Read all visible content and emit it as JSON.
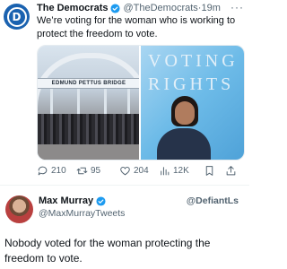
{
  "tweet": {
    "author_name": "The Democrats",
    "author_handle": "@TheDemocrats",
    "separator": "·",
    "time": "19m",
    "more": "···",
    "text": "We’re voting for the woman who is working to protect the freedom to vote.",
    "media": {
      "left_image_sign": "EDMUND PETTUS BRIDGE",
      "right_image_line1": "VOTING",
      "right_image_line2": "RIGHTS"
    },
    "actions": {
      "replies": "210",
      "retweets": "95",
      "likes": "204",
      "views": "12K"
    },
    "verified_color": "#1d9bf0"
  },
  "reply": {
    "author_name": "Max Murray",
    "author_handle": "@MaxMurrayTweets",
    "watermark_handle": "@DefiantLs",
    "text": "Nobody voted for the woman protecting the freedom to vote."
  },
  "colors": {
    "text": "#0f1419",
    "secondary": "#536471",
    "brand_blue": "#1a62b0"
  }
}
